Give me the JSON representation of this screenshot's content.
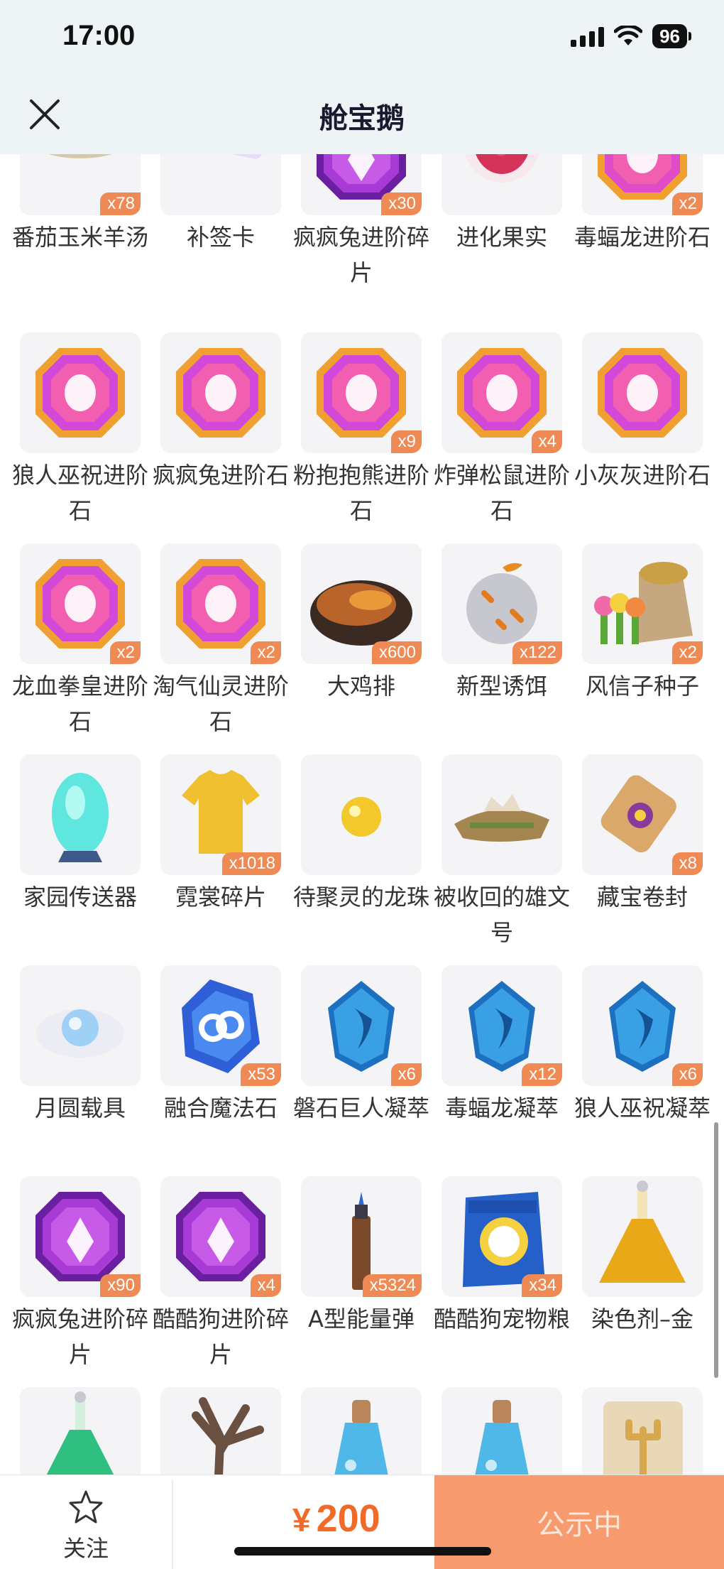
{
  "status_bar": {
    "time": "17:00",
    "battery": "96"
  },
  "header": {
    "title": "舱宝鹅"
  },
  "items": [
    {
      "name": "番茄玉米羊汤",
      "qty": "x78",
      "icon": "soup-bowl-icon",
      "color": "#e8a23c"
    },
    {
      "name": "补签卡",
      "qty": "",
      "icon": "ticket-card-icon",
      "color": "#b56cf0"
    },
    {
      "name": "疯疯兔进阶碎片",
      "qty": "x30",
      "icon": "purple-gem-carrot-icon",
      "color": "#a83ad6"
    },
    {
      "name": "进化果实",
      "qty": "",
      "icon": "raspberry-fruit-icon",
      "color": "#d4325a"
    },
    {
      "name": "毒蝠龙进阶石",
      "qty": "x2",
      "icon": "pink-gem-icon",
      "color": "#e04bc8"
    },
    {
      "name": "狼人巫祝进阶石",
      "qty": "",
      "icon": "gradient-gem-icon",
      "color": "#d248d8"
    },
    {
      "name": "疯疯兔进阶石",
      "qty": "",
      "icon": "gradient-gem-icon",
      "color": "#d248d8"
    },
    {
      "name": "粉抱抱熊进阶石",
      "qty": "x9",
      "icon": "gradient-gem-icon",
      "color": "#d248d8"
    },
    {
      "name": "炸弹松鼠进阶石",
      "qty": "x4",
      "icon": "gradient-gem-icon",
      "color": "#d248d8"
    },
    {
      "name": "小灰灰进阶石",
      "qty": "",
      "icon": "gradient-gem-icon",
      "color": "#d248d8"
    },
    {
      "name": "龙血拳皇进阶石",
      "qty": "x2",
      "icon": "gradient-gem-icon",
      "color": "#d248d8"
    },
    {
      "name": "淘气仙灵进阶石",
      "qty": "x2",
      "icon": "gradient-gem-icon",
      "color": "#d248d8"
    },
    {
      "name": "大鸡排",
      "qty": "x600",
      "icon": "fried-chicken-icon",
      "color": "#b8642a"
    },
    {
      "name": "新型诱饵",
      "qty": "x122",
      "icon": "bait-ball-icon",
      "color": "#c7c7d0"
    },
    {
      "name": "风信子种子",
      "qty": "x2",
      "icon": "seed-bag-icon",
      "color": "#caa046"
    },
    {
      "name": "家园传送器",
      "qty": "",
      "icon": "teleporter-icon",
      "color": "#5ee6df"
    },
    {
      "name": "霓裳碎片",
      "qty": "x1018",
      "icon": "shirt-icon",
      "color": "#f0c030"
    },
    {
      "name": "待聚灵的龙珠",
      "qty": "",
      "icon": "dragon-ball-icon",
      "color": "#f2c82a"
    },
    {
      "name": "被收回的雄文号",
      "qty": "",
      "icon": "ship-wreck-icon",
      "color": "#a58650"
    },
    {
      "name": "藏宝卷封",
      "qty": "x8",
      "icon": "scroll-icon",
      "color": "#d9a86a"
    },
    {
      "name": "月圆载具",
      "qty": "",
      "icon": "moon-cloud-icon",
      "color": "#9fd0f5"
    },
    {
      "name": "融合魔法石",
      "qty": "x53",
      "icon": "blue-crystal-icon",
      "color": "#2e5fd6"
    },
    {
      "name": "磐石巨人凝萃",
      "qty": "x6",
      "icon": "blue-essence-icon",
      "color": "#3aa0e6"
    },
    {
      "name": "毒蝠龙凝萃",
      "qty": "x12",
      "icon": "blue-essence-icon",
      "color": "#3aa0e6"
    },
    {
      "name": "狼人巫祝凝萃",
      "qty": "x6",
      "icon": "blue-essence-icon",
      "color": "#3aa0e6"
    },
    {
      "name": "疯疯兔进阶碎片",
      "qty": "x90",
      "icon": "purple-gem-carrot-icon",
      "color": "#a83ad6"
    },
    {
      "name": "酷酷狗进阶碎片",
      "qty": "x4",
      "icon": "purple-gem-icon",
      "color": "#a83ad6"
    },
    {
      "name": "A型能量弹",
      "qty": "x5324",
      "icon": "energy-bullet-icon",
      "color": "#7a4a2a"
    },
    {
      "name": "酷酷狗宠物粮",
      "qty": "x34",
      "icon": "pet-food-bag-icon",
      "color": "#2460c8"
    },
    {
      "name": "染色剂–金",
      "qty": "",
      "icon": "dye-flask-icon",
      "color": "#e8a818"
    },
    {
      "name": "",
      "qty": "",
      "icon": "green-flask-icon",
      "color": "#2fbf80"
    },
    {
      "name": "",
      "qty": "",
      "icon": "dead-tree-icon",
      "color": "#6a5040"
    },
    {
      "name": "",
      "qty": "",
      "icon": "blue-potion-icon",
      "color": "#4fb8e8"
    },
    {
      "name": "",
      "qty": "",
      "icon": "blue-potion-icon",
      "color": "#4fb8e8"
    },
    {
      "name": "",
      "qty": "",
      "icon": "trident-scroll-icon",
      "color": "#d8a850"
    }
  ],
  "bottom_bar": {
    "follow_label": "关注",
    "currency": "¥",
    "price": "200",
    "status_label": "公示中"
  }
}
